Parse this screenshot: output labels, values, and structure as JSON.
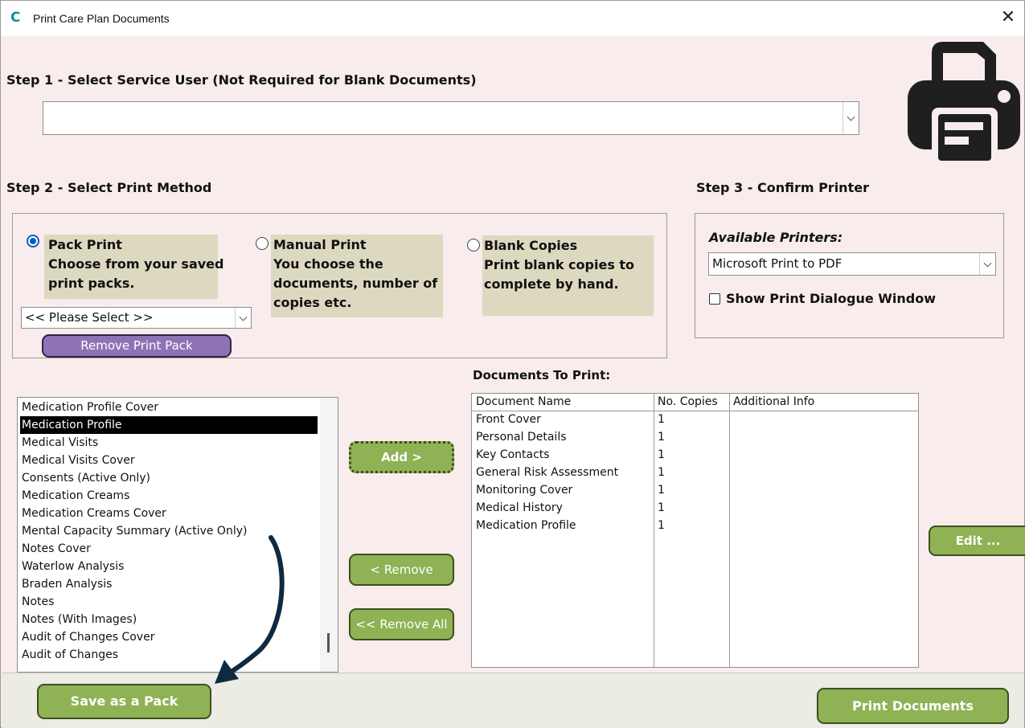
{
  "window": {
    "title": "Print Care Plan Documents",
    "app_icon_glyph": "C",
    "close_glyph": "✕"
  },
  "step1": {
    "heading": "Step 1 - Select Service User (Not Required for Blank Documents)",
    "service_user_value": ""
  },
  "step2": {
    "heading": "Step 2 - Select Print Method",
    "options": [
      {
        "title": "Pack Print",
        "desc_lines": [
          "Choose from your saved",
          "print packs."
        ],
        "selected": true
      },
      {
        "title": "Manual Print",
        "desc_lines": [
          "You choose the",
          "documents, number of",
          "copies etc."
        ],
        "selected": false
      },
      {
        "title": "Blank Copies",
        "desc_lines": [
          "Print blank copies to",
          "complete by hand."
        ],
        "selected": false
      }
    ],
    "pack_select_value": "<< Please Select >>",
    "remove_pack_label": "Remove Print Pack"
  },
  "step3": {
    "heading": "Step 3 - Confirm Printer",
    "available_printers_label": "Available Printers:",
    "printer_value": "Microsoft Print to PDF",
    "show_dialog_label": "Show Print Dialogue Window",
    "show_dialog_checked": false
  },
  "available_documents": [
    "Medication Profile Cover",
    "Medication Profile",
    "Medical Visits",
    "Medical Visits Cover",
    "Consents (Active Only)",
    "Medication Creams",
    "Medication Creams Cover",
    "Mental Capacity Summary (Active Only)",
    "Notes Cover",
    "Waterlow Analysis",
    "Braden Analysis",
    "Notes",
    "Notes (With Images)",
    "Audit of Changes Cover",
    "Audit of Changes"
  ],
  "selected_available_index": 1,
  "buttons": {
    "add": "Add >",
    "remove": "< Remove",
    "remove_all": "<< Remove All",
    "edit": "Edit ...",
    "save_pack": "Save as a Pack",
    "print": "Print Documents"
  },
  "documents_to_print": {
    "heading": "Documents To Print:",
    "columns": [
      "Document Name",
      "No. Copies",
      "Additional Info"
    ],
    "rows": [
      [
        "Front Cover",
        "1",
        ""
      ],
      [
        "Personal Details",
        "1",
        ""
      ],
      [
        "Key Contacts",
        "1",
        ""
      ],
      [
        "General Risk Assessment",
        "1",
        ""
      ],
      [
        "Monitoring Cover",
        "1",
        ""
      ],
      [
        "Medical History",
        "1",
        ""
      ],
      [
        "Medication Profile",
        "1",
        ""
      ]
    ]
  },
  "icons": {
    "printer": "printer-icon",
    "arrow": "curved-arrow-icon"
  },
  "colors": {
    "background": "#f8ecec",
    "option_panel": "#ddd8c0",
    "green_button": "#8fb255",
    "purple_button": "#8f72b5",
    "radio_selected": "#0b5dbd",
    "arrow": "#0f2a40"
  }
}
